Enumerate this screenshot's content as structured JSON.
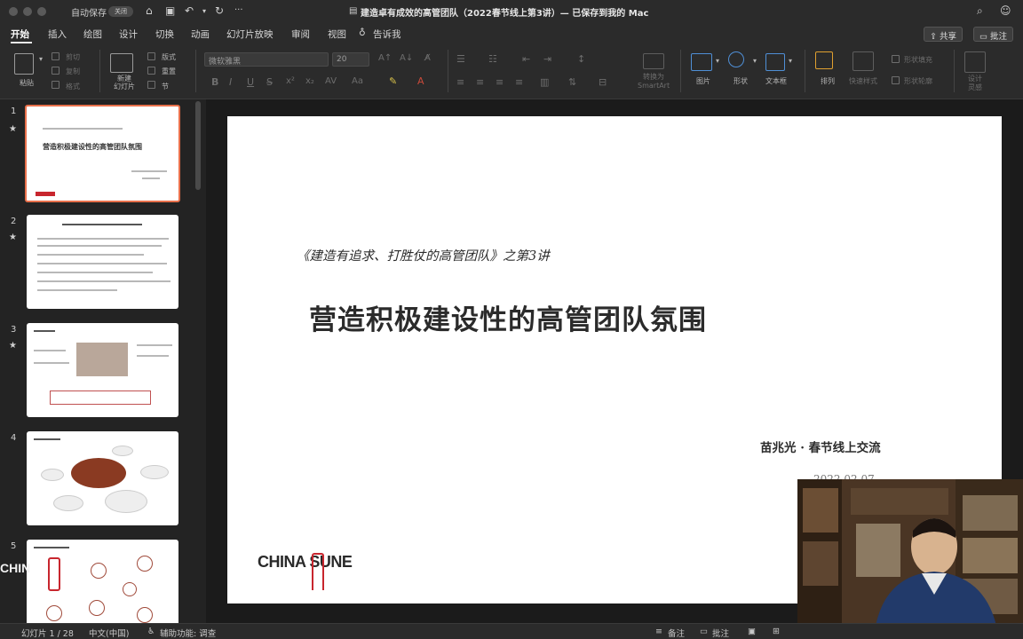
{
  "titlebar": {
    "autosave_label": "自动保存",
    "autosave_state": "关闭",
    "document_title": "建造卓有成效的高管团队（2022春节线上第3讲）— 已保存到我的 Mac",
    "more": "···"
  },
  "tabs": [
    {
      "label": "开始",
      "active": true
    },
    {
      "label": "插入"
    },
    {
      "label": "绘图"
    },
    {
      "label": "设计"
    },
    {
      "label": "切换"
    },
    {
      "label": "动画"
    },
    {
      "label": "幻灯片放映"
    },
    {
      "label": "审阅"
    },
    {
      "label": "视图"
    },
    {
      "label": "告诉我"
    }
  ],
  "ribbon_right": {
    "share": "共享",
    "comment": "批注"
  },
  "toolbar": {
    "paste": "粘贴",
    "cut": "剪切",
    "copy": "复制",
    "format": "格式",
    "new_slide": "新建\n幻灯片",
    "layout": "版式",
    "reset": "重置",
    "section": "节",
    "font_name": "微软雅黑",
    "font_size": "20",
    "convert_smartart": "转换为\nSmartArt",
    "picture": "图片",
    "shape": "形状",
    "textbox": "文本框",
    "arrange": "排列",
    "quick_styles": "快速样式",
    "shape_fill": "形状填充",
    "shape_outline": "形状轮廓",
    "design_ideas": "设计\n灵感"
  },
  "thumbnails": [
    {
      "number": "1",
      "star": "★",
      "title": "营造积极建设性的高管团队氛围"
    },
    {
      "number": "2",
      "star": "★"
    },
    {
      "number": "3",
      "star": "★"
    },
    {
      "number": "4"
    },
    {
      "number": "5"
    }
  ],
  "slide": {
    "subtitle": "《建造有追求、打胜仗的高管团队》之第3讲",
    "title": "营造积极建设性的高管团队氛围",
    "presenter": "苗兆光 · 春节线上交流",
    "date": "2022.02.07",
    "logo": "CHINA SUNE"
  },
  "statusbar": {
    "slide_count": "幻灯片 1 / 28",
    "language": "中文(中国)",
    "accessibility": "辅助功能: 调查",
    "notes": "备注",
    "comments": "批注"
  },
  "colors": {
    "accent": "#e8704b",
    "logo_red": "#c8262e"
  }
}
